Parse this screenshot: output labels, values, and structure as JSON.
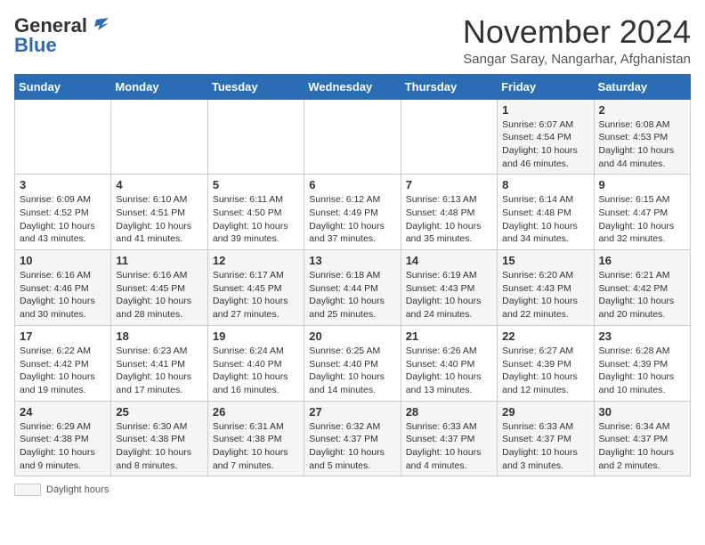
{
  "header": {
    "logo_general": "General",
    "logo_blue": "Blue",
    "title": "November 2024",
    "subtitle": "Sangar Saray, Nangarhar, Afghanistan"
  },
  "calendar": {
    "weekdays": [
      "Sunday",
      "Monday",
      "Tuesday",
      "Wednesday",
      "Thursday",
      "Friday",
      "Saturday"
    ],
    "weeks": [
      [
        {
          "day": "",
          "info": ""
        },
        {
          "day": "",
          "info": ""
        },
        {
          "day": "",
          "info": ""
        },
        {
          "day": "",
          "info": ""
        },
        {
          "day": "",
          "info": ""
        },
        {
          "day": "1",
          "info": "Sunrise: 6:07 AM\nSunset: 4:54 PM\nDaylight: 10 hours and 46 minutes."
        },
        {
          "day": "2",
          "info": "Sunrise: 6:08 AM\nSunset: 4:53 PM\nDaylight: 10 hours and 44 minutes."
        }
      ],
      [
        {
          "day": "3",
          "info": "Sunrise: 6:09 AM\nSunset: 4:52 PM\nDaylight: 10 hours and 43 minutes."
        },
        {
          "day": "4",
          "info": "Sunrise: 6:10 AM\nSunset: 4:51 PM\nDaylight: 10 hours and 41 minutes."
        },
        {
          "day": "5",
          "info": "Sunrise: 6:11 AM\nSunset: 4:50 PM\nDaylight: 10 hours and 39 minutes."
        },
        {
          "day": "6",
          "info": "Sunrise: 6:12 AM\nSunset: 4:49 PM\nDaylight: 10 hours and 37 minutes."
        },
        {
          "day": "7",
          "info": "Sunrise: 6:13 AM\nSunset: 4:48 PM\nDaylight: 10 hours and 35 minutes."
        },
        {
          "day": "8",
          "info": "Sunrise: 6:14 AM\nSunset: 4:48 PM\nDaylight: 10 hours and 34 minutes."
        },
        {
          "day": "9",
          "info": "Sunrise: 6:15 AM\nSunset: 4:47 PM\nDaylight: 10 hours and 32 minutes."
        }
      ],
      [
        {
          "day": "10",
          "info": "Sunrise: 6:16 AM\nSunset: 4:46 PM\nDaylight: 10 hours and 30 minutes."
        },
        {
          "day": "11",
          "info": "Sunrise: 6:16 AM\nSunset: 4:45 PM\nDaylight: 10 hours and 28 minutes."
        },
        {
          "day": "12",
          "info": "Sunrise: 6:17 AM\nSunset: 4:45 PM\nDaylight: 10 hours and 27 minutes."
        },
        {
          "day": "13",
          "info": "Sunrise: 6:18 AM\nSunset: 4:44 PM\nDaylight: 10 hours and 25 minutes."
        },
        {
          "day": "14",
          "info": "Sunrise: 6:19 AM\nSunset: 4:43 PM\nDaylight: 10 hours and 24 minutes."
        },
        {
          "day": "15",
          "info": "Sunrise: 6:20 AM\nSunset: 4:43 PM\nDaylight: 10 hours and 22 minutes."
        },
        {
          "day": "16",
          "info": "Sunrise: 6:21 AM\nSunset: 4:42 PM\nDaylight: 10 hours and 20 minutes."
        }
      ],
      [
        {
          "day": "17",
          "info": "Sunrise: 6:22 AM\nSunset: 4:42 PM\nDaylight: 10 hours and 19 minutes."
        },
        {
          "day": "18",
          "info": "Sunrise: 6:23 AM\nSunset: 4:41 PM\nDaylight: 10 hours and 17 minutes."
        },
        {
          "day": "19",
          "info": "Sunrise: 6:24 AM\nSunset: 4:40 PM\nDaylight: 10 hours and 16 minutes."
        },
        {
          "day": "20",
          "info": "Sunrise: 6:25 AM\nSunset: 4:40 PM\nDaylight: 10 hours and 14 minutes."
        },
        {
          "day": "21",
          "info": "Sunrise: 6:26 AM\nSunset: 4:40 PM\nDaylight: 10 hours and 13 minutes."
        },
        {
          "day": "22",
          "info": "Sunrise: 6:27 AM\nSunset: 4:39 PM\nDaylight: 10 hours and 12 minutes."
        },
        {
          "day": "23",
          "info": "Sunrise: 6:28 AM\nSunset: 4:39 PM\nDaylight: 10 hours and 10 minutes."
        }
      ],
      [
        {
          "day": "24",
          "info": "Sunrise: 6:29 AM\nSunset: 4:38 PM\nDaylight: 10 hours and 9 minutes."
        },
        {
          "day": "25",
          "info": "Sunrise: 6:30 AM\nSunset: 4:38 PM\nDaylight: 10 hours and 8 minutes."
        },
        {
          "day": "26",
          "info": "Sunrise: 6:31 AM\nSunset: 4:38 PM\nDaylight: 10 hours and 7 minutes."
        },
        {
          "day": "27",
          "info": "Sunrise: 6:32 AM\nSunset: 4:37 PM\nDaylight: 10 hours and 5 minutes."
        },
        {
          "day": "28",
          "info": "Sunrise: 6:33 AM\nSunset: 4:37 PM\nDaylight: 10 hours and 4 minutes."
        },
        {
          "day": "29",
          "info": "Sunrise: 6:33 AM\nSunset: 4:37 PM\nDaylight: 10 hours and 3 minutes."
        },
        {
          "day": "30",
          "info": "Sunrise: 6:34 AM\nSunset: 4:37 PM\nDaylight: 10 hours and 2 minutes."
        }
      ]
    ]
  },
  "footer": {
    "daylight_label": "Daylight hours"
  }
}
